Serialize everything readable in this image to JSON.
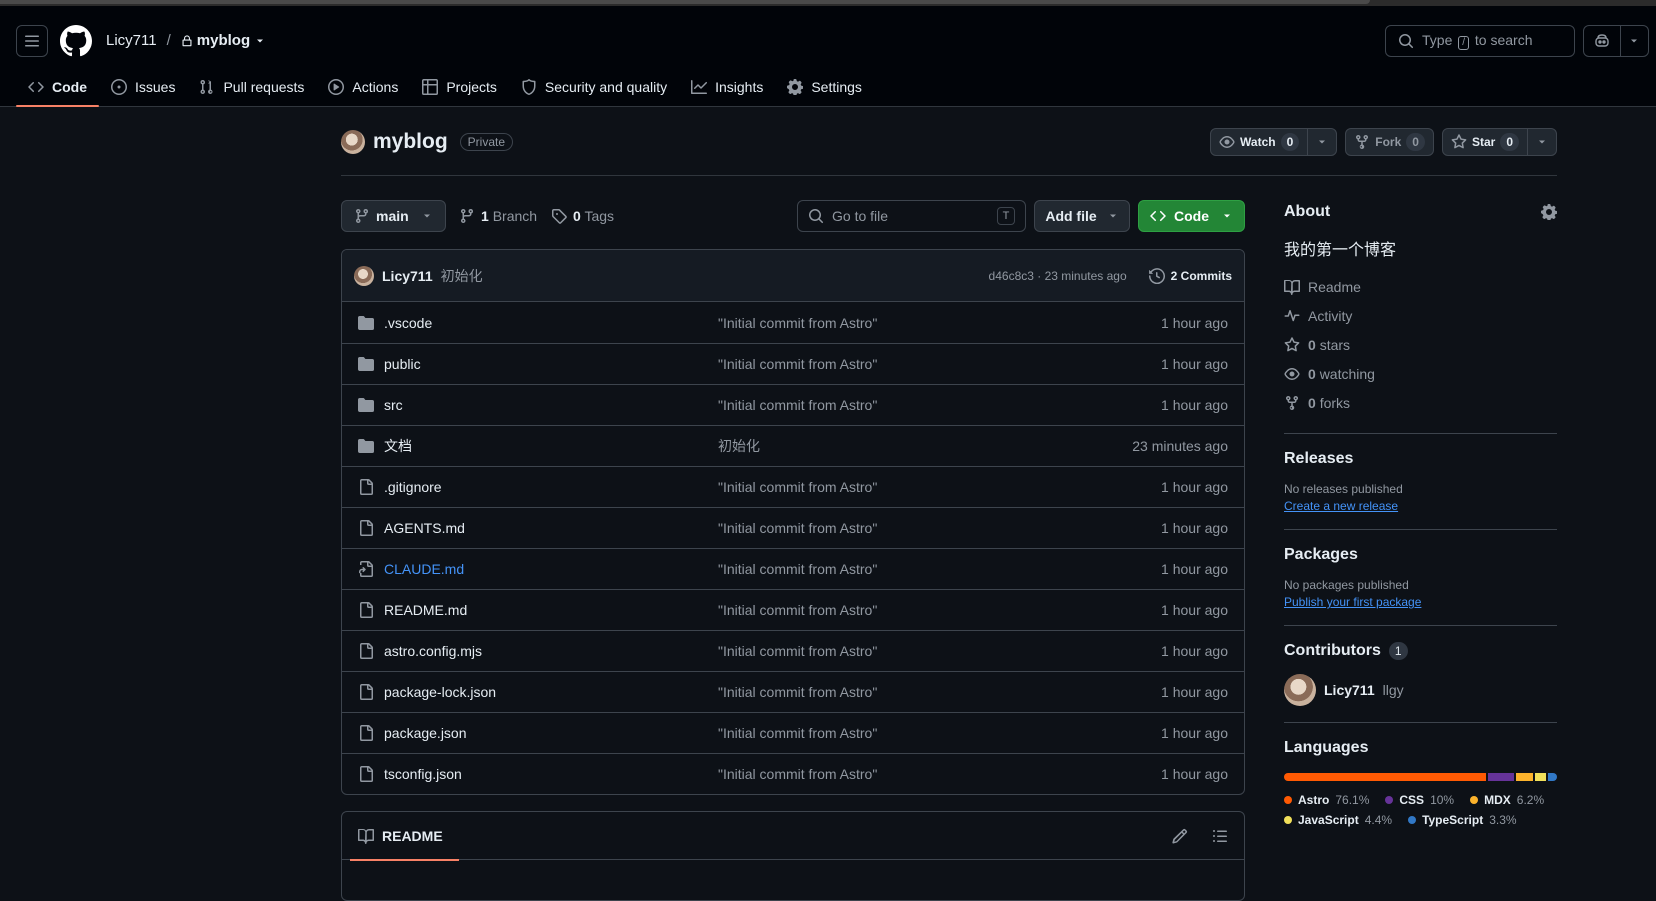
{
  "header": {
    "owner": "Licy711",
    "separator": "/",
    "repo": "myblog",
    "search_prefix": "Type",
    "search_key": "/",
    "search_suffix": "to search"
  },
  "tabs": [
    {
      "label": "Code",
      "icon": "code-icon",
      "active": true
    },
    {
      "label": "Issues",
      "icon": "issue-icon"
    },
    {
      "label": "Pull requests",
      "icon": "pull-request-icon"
    },
    {
      "label": "Actions",
      "icon": "play-icon"
    },
    {
      "label": "Projects",
      "icon": "table-icon"
    },
    {
      "label": "Security and quality",
      "icon": "shield-icon"
    },
    {
      "label": "Insights",
      "icon": "graph-icon"
    },
    {
      "label": "Settings",
      "icon": "gear-icon"
    }
  ],
  "repo_head": {
    "name": "myblog",
    "visibility": "Private",
    "watch_label": "Watch",
    "watch_count": "0",
    "fork_label": "Fork",
    "fork_count": "0",
    "star_label": "Star",
    "star_count": "0"
  },
  "toolbar": {
    "branch": "main",
    "branch_count": "1",
    "branch_label": "Branch",
    "tag_count": "0",
    "tag_label": "Tags",
    "goto_placeholder": "Go to file",
    "goto_key": "T",
    "add_file": "Add file",
    "code_button": "Code"
  },
  "latest_commit": {
    "author": "Licy711",
    "message": "初始化",
    "sha_time": "d46c8c3 · 23 minutes ago",
    "commits": "2 Commits"
  },
  "files": [
    {
      "name": ".vscode",
      "type": "folder",
      "message": "\"Initial commit from Astro\"",
      "age": "1 hour ago"
    },
    {
      "name": "public",
      "type": "folder",
      "message": "\"Initial commit from Astro\"",
      "age": "1 hour ago"
    },
    {
      "name": "src",
      "type": "folder",
      "message": "\"Initial commit from Astro\"",
      "age": "1 hour ago"
    },
    {
      "name": "文档",
      "type": "folder",
      "message": "初始化",
      "age": "23 minutes ago"
    },
    {
      "name": ".gitignore",
      "type": "file",
      "message": "\"Initial commit from Astro\"",
      "age": "1 hour ago"
    },
    {
      "name": "AGENTS.md",
      "type": "file",
      "message": "\"Initial commit from Astro\"",
      "age": "1 hour ago"
    },
    {
      "name": "CLAUDE.md",
      "type": "symlink",
      "message": "\"Initial commit from Astro\"",
      "age": "1 hour ago"
    },
    {
      "name": "README.md",
      "type": "file",
      "message": "\"Initial commit from Astro\"",
      "age": "1 hour ago"
    },
    {
      "name": "astro.config.mjs",
      "type": "file",
      "message": "\"Initial commit from Astro\"",
      "age": "1 hour ago"
    },
    {
      "name": "package-lock.json",
      "type": "file",
      "message": "\"Initial commit from Astro\"",
      "age": "1 hour ago"
    },
    {
      "name": "package.json",
      "type": "file",
      "message": "\"Initial commit from Astro\"",
      "age": "1 hour ago"
    },
    {
      "name": "tsconfig.json",
      "type": "file",
      "message": "\"Initial commit from Astro\"",
      "age": "1 hour ago"
    }
  ],
  "readme": {
    "tab": "README"
  },
  "sidebar": {
    "about_title": "About",
    "description": "我的第一个博客",
    "stats": [
      {
        "label": "Readme",
        "icon": "book-icon"
      },
      {
        "label": "Activity",
        "icon": "pulse-icon"
      },
      {
        "count": "0",
        "label": "stars",
        "icon": "star-icon"
      },
      {
        "count": "0",
        "label": "watching",
        "icon": "eye-icon"
      },
      {
        "count": "0",
        "label": "forks",
        "icon": "fork-icon"
      }
    ],
    "releases_title": "Releases",
    "releases_text": "No releases published",
    "releases_link": "Create a new release",
    "packages_title": "Packages",
    "packages_text": "No packages published",
    "packages_link": "Publish your first package",
    "contributors_title": "Contributors",
    "contributors_count": "1",
    "contributor_name": "Licy711",
    "contributor_sub": "llgy",
    "languages_title": "Languages",
    "languages": [
      {
        "name": "Astro",
        "pct": "76.1%",
        "value": 76.1,
        "color": "#ff5a03"
      },
      {
        "name": "CSS",
        "pct": "10%",
        "value": 10.0,
        "color": "#663399"
      },
      {
        "name": "MDX",
        "pct": "6.2%",
        "value": 6.2,
        "color": "#fcb32c"
      },
      {
        "name": "JavaScript",
        "pct": "4.4%",
        "value": 4.4,
        "color": "#f1e05a"
      },
      {
        "name": "TypeScript",
        "pct": "3.3%",
        "value": 3.3,
        "color": "#3178c6"
      }
    ]
  }
}
